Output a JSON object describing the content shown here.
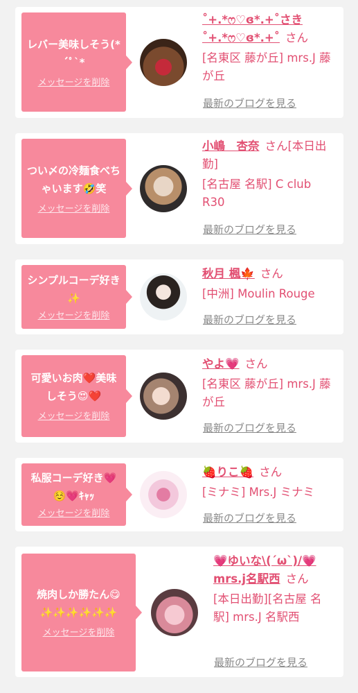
{
  "delete_label": "メッセージを削除",
  "blog_label": "最新のブログを見る",
  "cards": [
    {
      "message": "レバー美味しそう(*´ﾟ`*",
      "name": "˚+.*ෆ♡ɞ*.+˚さき˚+.*ෆ♡ɞ*.+˚",
      "suffix": "さん",
      "shop": "[名東区 藤が丘] mrs.J 藤が丘"
    },
    {
      "message": "つい〆の冷麺食べちゃいます🤣笑",
      "name": "小嶋　杏奈",
      "suffix": "さん[本日出勤]",
      "shop": "[名古屋 名駅] C club R30"
    },
    {
      "message": "シンプルコーデ好き✨",
      "name": "秋月 楓🍁",
      "suffix": "さん",
      "shop": "[中洲] Moulin Rouge"
    },
    {
      "message": "可愛いお肉❤️美味しそう😍❤️",
      "name": "やよ💗",
      "suffix": "さん",
      "shop": "[名東区 藤が丘] mrs.J 藤が丘"
    },
    {
      "message": "私服コーデ好き💗☺️💗ｷｬｯ",
      "name": "🍓りこ🍓",
      "suffix": "さん",
      "shop": "[ミナミ] Mrs.J ミナミ"
    },
    {
      "message": "焼肉しか勝たん😋✨✨✨✨✨✨",
      "name": "💗ゆいな\\(´ω`)/💗mrs.j名駅西",
      "suffix": "さん",
      "shop": "[本日出勤][名古屋 名駅] mrs.J 名駅西"
    }
  ],
  "colors": {
    "bubble": "#f7899c",
    "accent": "#e24f72",
    "muted": "#8a8a8a",
    "background": "#f2f2f2"
  },
  "avatar_icons": [
    "profile-photo-icon",
    "profile-photo-icon",
    "profile-photo-icon",
    "profile-photo-icon",
    "profile-illustration-icon",
    "profile-photo-icon"
  ]
}
